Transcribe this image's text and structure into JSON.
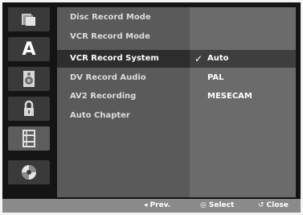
{
  "sidebar": {
    "icons": [
      {
        "name": "disc-icon"
      },
      {
        "name": "language-icon",
        "glyph": "A"
      },
      {
        "name": "audio-speaker-icon"
      },
      {
        "name": "lock-icon"
      },
      {
        "name": "record-film-icon"
      },
      {
        "name": "disc-play-icon"
      }
    ],
    "active_index": 4
  },
  "menu": {
    "items": [
      {
        "label": "Disc Record Mode"
      },
      {
        "label": "VCR Record Mode"
      },
      {
        "label": "VCR Record System"
      },
      {
        "label": "DV Record Audio"
      },
      {
        "label": "AV2 Recording"
      },
      {
        "label": "Auto Chapter"
      }
    ],
    "selected_index": 2
  },
  "options": {
    "items": [
      {
        "label": "Auto"
      },
      {
        "label": "PAL"
      },
      {
        "label": "MESECAM"
      }
    ],
    "selected_index": 0,
    "check_glyph": "✓"
  },
  "footer": {
    "prev": {
      "symbol": "◂",
      "label": "Prev."
    },
    "select": {
      "symbol": "◎",
      "label": "Select"
    },
    "close": {
      "symbol": "↺",
      "label": "Close"
    }
  },
  "colors": {
    "screen_bg": "#141414",
    "menu_bg": "#5a5a5a",
    "options_bg": "#6b6b6b",
    "footer_bg": "#8a8a8a",
    "selected_row": "#2d2d2d"
  }
}
